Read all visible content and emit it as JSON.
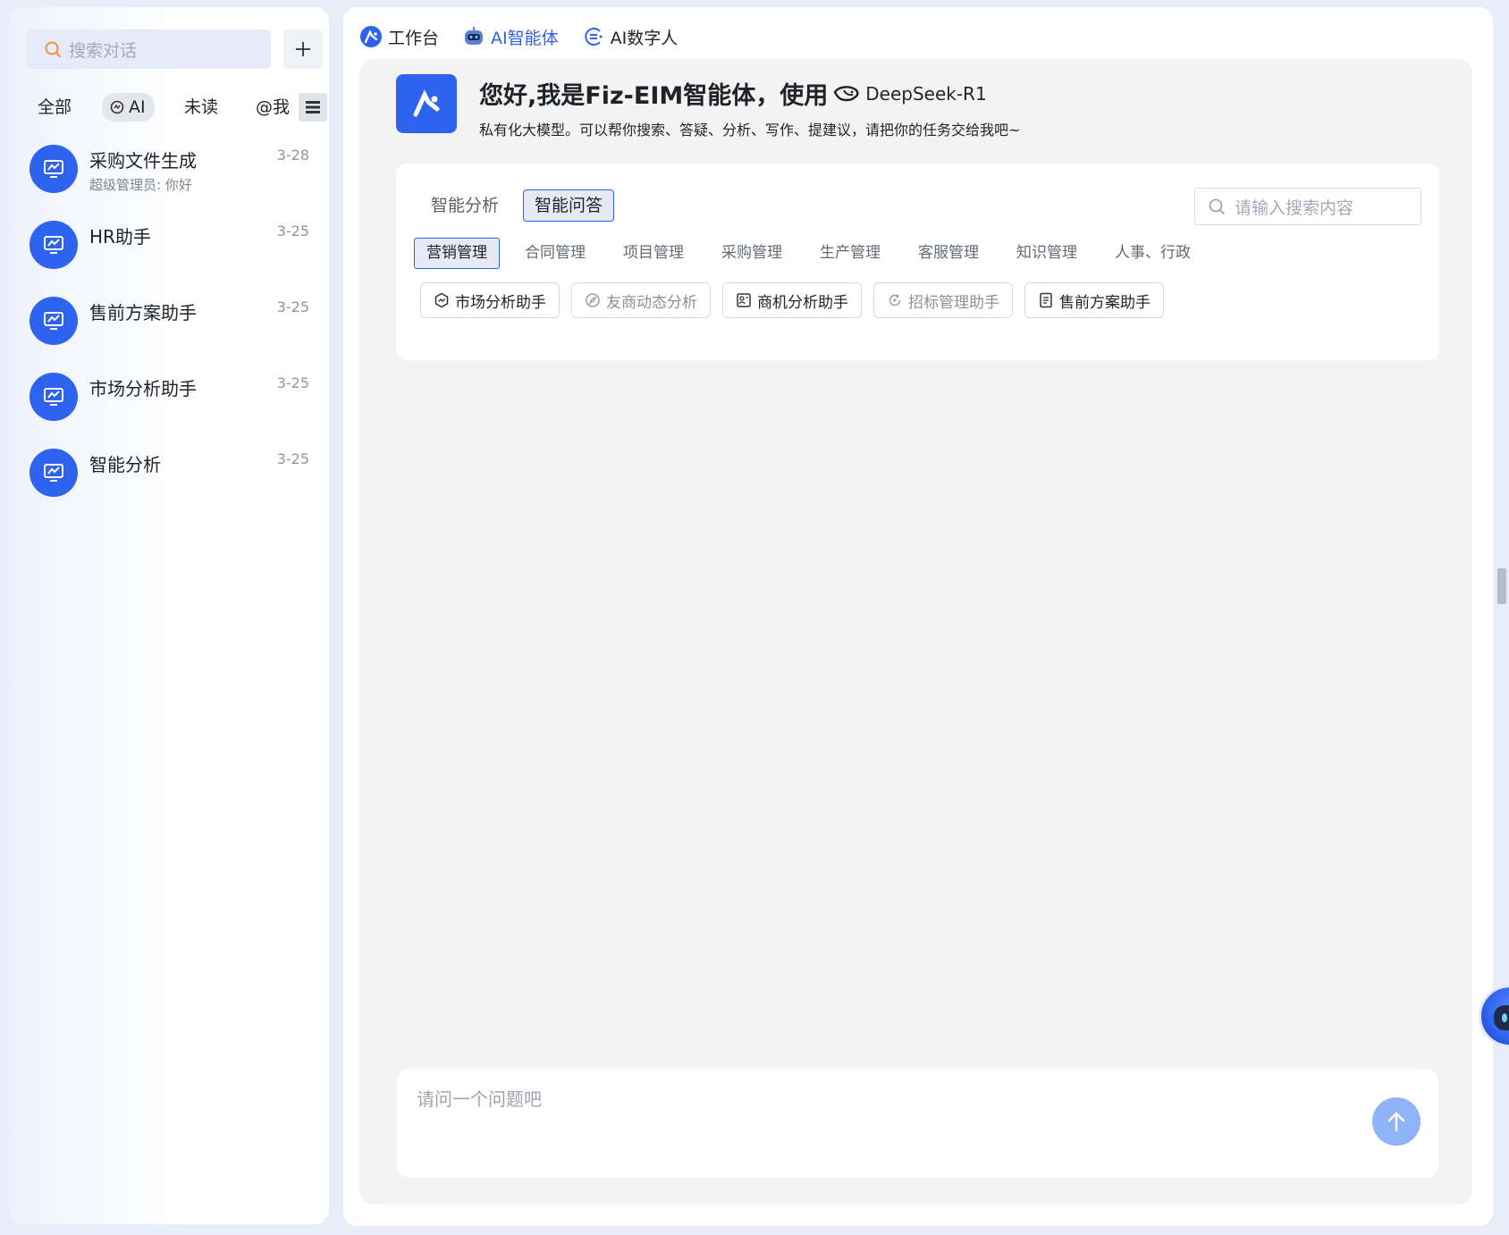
{
  "sidebar": {
    "search_placeholder": "搜索对话",
    "filters": {
      "all": "全部",
      "ai": "AI",
      "unread": "未读",
      "mention": "@我"
    },
    "conversations": [
      {
        "title": "采购文件生成",
        "subtitle": "超级管理员: 你好",
        "date": "3-28"
      },
      {
        "title": "HR助手",
        "subtitle": "",
        "date": "3-25"
      },
      {
        "title": "售前方案助手",
        "subtitle": "",
        "date": "3-25"
      },
      {
        "title": "市场分析助手",
        "subtitle": "",
        "date": "3-25"
      },
      {
        "title": "智能分析",
        "subtitle": "",
        "date": "3-25"
      }
    ]
  },
  "top_tabs": {
    "workbench": "工作台",
    "ai_agent": "AI智能体",
    "ai_avatar": "AI数字人"
  },
  "greeting": {
    "title": "您好,我是Fiz-EIM智能体，使用",
    "model": "DeepSeek-R1",
    "description": "私有化大模型。可以帮你搜索、答疑、分析、写作、提建议，请把你的任务交给我吧~"
  },
  "card": {
    "mode_tabs": [
      "智能分析",
      "智能问答"
    ],
    "active_mode": "智能问答",
    "search_placeholder": "请输入搜索内容",
    "categories": [
      "营销管理",
      "合同管理",
      "项目管理",
      "采购管理",
      "生产管理",
      "客服管理",
      "知识管理",
      "人事、行政"
    ],
    "active_category": "营销管理",
    "assistants": [
      {
        "label": "市场分析助手",
        "icon": "hexagon-chart-icon",
        "enabled": true
      },
      {
        "label": "友商动态分析",
        "icon": "compass-icon",
        "enabled": false
      },
      {
        "label": "商机分析助手",
        "icon": "id-card-icon",
        "enabled": true
      },
      {
        "label": "招标管理助手",
        "icon": "refresh-icon",
        "enabled": false
      },
      {
        "label": "售前方案助手",
        "icon": "document-icon",
        "enabled": true
      }
    ]
  },
  "input": {
    "placeholder": "请问一个问题吧"
  },
  "colors": {
    "accent": "#2e63f0",
    "send_button": "#8fb2f8",
    "content_bg": "#f3f3f3"
  }
}
